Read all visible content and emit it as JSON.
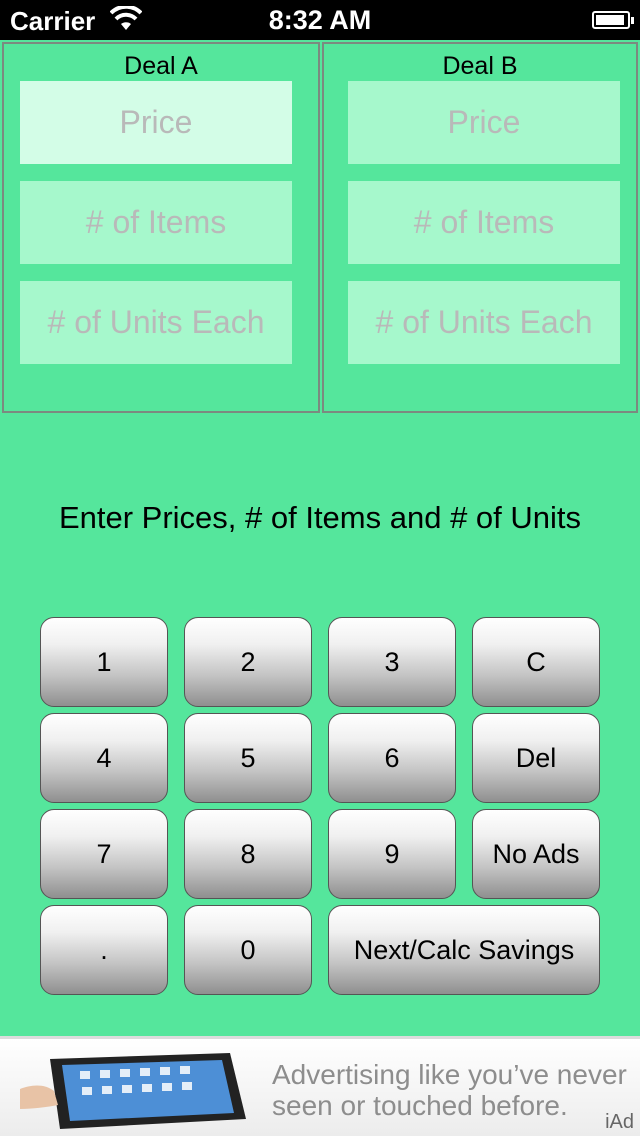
{
  "status_bar": {
    "carrier": "Carrier",
    "time": "8:32 AM",
    "wifi_icon": "wifi-icon",
    "battery_icon": "battery-icon"
  },
  "deals": {
    "a": {
      "title": "Deal A",
      "price_placeholder": "Price",
      "items_placeholder": "# of Items",
      "units_placeholder": "# of Units Each"
    },
    "b": {
      "title": "Deal B",
      "price_placeholder": "Price",
      "items_placeholder": "# of Items",
      "units_placeholder": "# of Units Each"
    }
  },
  "instructions": "Enter Prices, # of Items and # of Units",
  "keypad": {
    "k1": "1",
    "k2": "2",
    "k3": "3",
    "clear": "C",
    "k4": "4",
    "k5": "5",
    "k6": "6",
    "del": "Del",
    "k7": "7",
    "k8": "8",
    "k9": "9",
    "no_ads": "No Ads",
    "dot": ".",
    "k0": "0",
    "next": "Next/Calc Savings"
  },
  "ad": {
    "text": "Advertising like you’ve never seen or touched before.",
    "badge": "iAd"
  },
  "colors": {
    "background": "#55e69c",
    "field": "#a6f8cc",
    "field_active": "#d3fde7"
  }
}
